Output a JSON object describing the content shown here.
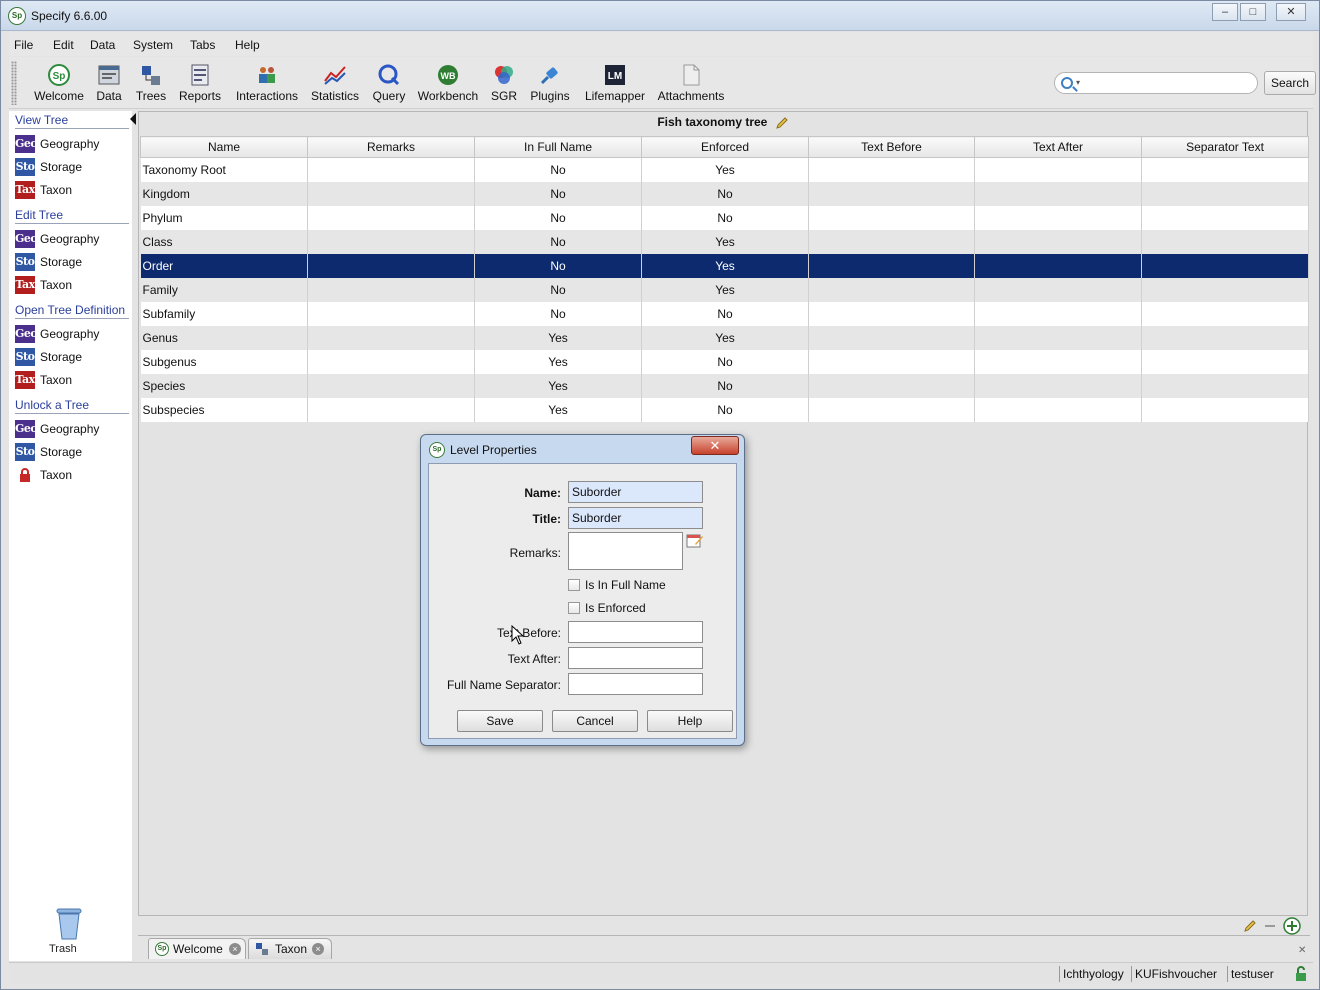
{
  "app": {
    "title": "Specify 6.6.00",
    "logo_text": "Sp"
  },
  "window_controls": {
    "minimize": "–",
    "maximize": "□",
    "close": "✕"
  },
  "menu": [
    "File",
    "Edit",
    "Data",
    "System",
    "Tabs",
    "Help"
  ],
  "toolbar": {
    "buttons": [
      "Welcome",
      "Data",
      "Trees",
      "Reports",
      "Interactions",
      "Statistics",
      "Query",
      "Workbench",
      "SGR",
      "Plugins",
      "Lifemapper",
      "Attachments"
    ],
    "search_placeholder": "",
    "search_button": "Search"
  },
  "sidebar": {
    "sections": [
      {
        "title": "View Tree",
        "items": [
          {
            "badge": "Geo",
            "label": "Geography"
          },
          {
            "badge": "Sto",
            "label": "Storage"
          },
          {
            "badge": "Tax",
            "label": "Taxon"
          }
        ]
      },
      {
        "title": "Edit Tree",
        "items": [
          {
            "badge": "Geo",
            "label": "Geography"
          },
          {
            "badge": "Sto",
            "label": "Storage"
          },
          {
            "badge": "Tax",
            "label": "Taxon"
          }
        ]
      },
      {
        "title": "Open Tree Definition",
        "items": [
          {
            "badge": "Geo",
            "label": "Geography"
          },
          {
            "badge": "Sto",
            "label": "Storage"
          },
          {
            "badge": "Tax",
            "label": "Taxon"
          }
        ]
      },
      {
        "title": "Unlock a Tree",
        "items": [
          {
            "badge": "Geo",
            "label": "Geography"
          },
          {
            "badge": "Sto",
            "label": "Storage"
          },
          {
            "badge": "lock-icon",
            "label": "Taxon"
          }
        ]
      }
    ],
    "trash_label": "Trash"
  },
  "panel": {
    "title": "Fish taxonomy tree",
    "columns": [
      "Name",
      "Remarks",
      "In Full Name",
      "Enforced",
      "Text Before",
      "Text After",
      "Separator Text"
    ],
    "rows": [
      [
        "Taxonomy Root",
        "",
        "No",
        "Yes",
        "",
        "",
        ""
      ],
      [
        "Kingdom",
        "",
        "No",
        "No",
        "",
        "",
        ""
      ],
      [
        "Phylum",
        "",
        "No",
        "No",
        "",
        "",
        ""
      ],
      [
        "Class",
        "",
        "No",
        "Yes",
        "",
        "",
        ""
      ],
      [
        "Order",
        "",
        "No",
        "Yes",
        "",
        "",
        ""
      ],
      [
        "Family",
        "",
        "No",
        "Yes",
        "",
        "",
        ""
      ],
      [
        "Subfamily",
        "",
        "No",
        "No",
        "",
        "",
        ""
      ],
      [
        "Genus",
        "",
        "Yes",
        "Yes",
        "",
        "",
        ""
      ],
      [
        "Subgenus",
        "",
        "Yes",
        "No",
        "",
        "",
        ""
      ],
      [
        "Species",
        "",
        "Yes",
        "No",
        "",
        "",
        ""
      ],
      [
        "Subspecies",
        "",
        "Yes",
        "No",
        "",
        "",
        ""
      ]
    ],
    "selected_row": 4
  },
  "tabs": [
    {
      "label": "Welcome"
    },
    {
      "label": "Taxon"
    }
  ],
  "status": {
    "discipline": "Ichthyology",
    "collection": "KUFishvoucher",
    "user": "testuser"
  },
  "dialog": {
    "title": "Level Properties",
    "fields": {
      "name_label": "Name:",
      "name_value": "Suborder",
      "title_label": "Title:",
      "title_value": "Suborder",
      "remarks_label": "Remarks:",
      "in_full_name_label": "Is In Full Name",
      "enforced_label": "Is Enforced",
      "text_before_label": "Text Before:",
      "text_after_label": "Text After:",
      "separator_label": "Full Name Separator:"
    },
    "buttons": {
      "save": "Save",
      "cancel": "Cancel",
      "help": "Help"
    }
  },
  "colors": {
    "selection": "#0d2a6e",
    "geo": "#4a2f8c",
    "sto": "#2f57a3",
    "tax": "#b21e1e",
    "link": "#2a3f9c"
  }
}
